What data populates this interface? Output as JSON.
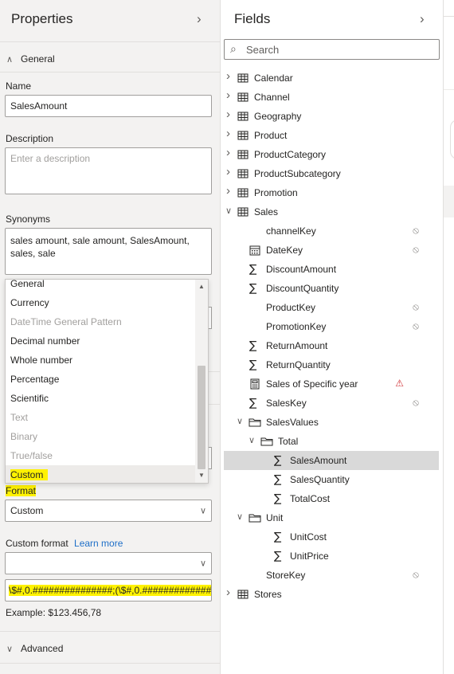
{
  "properties": {
    "title": "Properties",
    "general_label": "General",
    "name_label": "Name",
    "name_value": "SalesAmount",
    "description_label": "Description",
    "description_placeholder": "Enter a description",
    "synonyms_label": "Synonyms",
    "synonyms_value": "sales amount, sale amount, SalesAmount, sales, sale",
    "format_options": [
      {
        "label": "General",
        "enabled": true
      },
      {
        "label": "Currency",
        "enabled": true
      },
      {
        "label": "DateTime General Pattern",
        "enabled": false
      },
      {
        "label": "Decimal number",
        "enabled": true
      },
      {
        "label": "Whole number",
        "enabled": true
      },
      {
        "label": "Percentage",
        "enabled": true
      },
      {
        "label": "Scientific",
        "enabled": true
      },
      {
        "label": "Text",
        "enabled": false
      },
      {
        "label": "Binary",
        "enabled": false
      },
      {
        "label": "True/false",
        "enabled": false
      },
      {
        "label": "Custom",
        "enabled": true
      }
    ],
    "format_label": "Format",
    "format_value": "Custom",
    "custom_format_label": "Custom format",
    "learn_more": "Learn more",
    "custom_format_select_value": "",
    "custom_format_value": "\\$#,0.###############;(\\$#,0.###############",
    "example_text": "Example: $123.456,78",
    "advanced_label": "Advanced",
    "highlight_color": "#fff200"
  },
  "fields": {
    "title": "Fields",
    "search_placeholder": "Search",
    "tables": [
      "Calendar",
      "Channel",
      "Geography",
      "Product",
      "ProductCategory",
      "ProductSubcategory",
      "Promotion"
    ],
    "sales_table": "Sales",
    "sales_items": [
      {
        "name": "channelKey",
        "icon": "none",
        "hidden": true
      },
      {
        "name": "DateKey",
        "icon": "calendar-icon",
        "hidden": true
      },
      {
        "name": "DiscountAmount",
        "icon": "sigma-icon",
        "hidden": false
      },
      {
        "name": "DiscountQuantity",
        "icon": "sigma-icon",
        "hidden": false
      },
      {
        "name": "ProductKey",
        "icon": "none",
        "hidden": true
      },
      {
        "name": "PromotionKey",
        "icon": "none",
        "hidden": true
      },
      {
        "name": "ReturnAmount",
        "icon": "sigma-icon",
        "hidden": false
      },
      {
        "name": "ReturnQuantity",
        "icon": "sigma-icon",
        "hidden": false
      },
      {
        "name": "Sales of Specific year",
        "icon": "calculator-icon",
        "hidden": false,
        "warning": true
      },
      {
        "name": "SalesKey",
        "icon": "sigma-icon",
        "hidden": true
      }
    ],
    "sales_values_folder": "SalesValues",
    "total_folder": "Total",
    "total_items": [
      "SalesAmount",
      "SalesQuantity",
      "TotalCost"
    ],
    "unit_folder": "Unit",
    "unit_items": [
      "UnitCost",
      "UnitPrice"
    ],
    "store_key": "StoreKey",
    "stores_table": "Stores",
    "selected_field": "SalesAmount"
  }
}
